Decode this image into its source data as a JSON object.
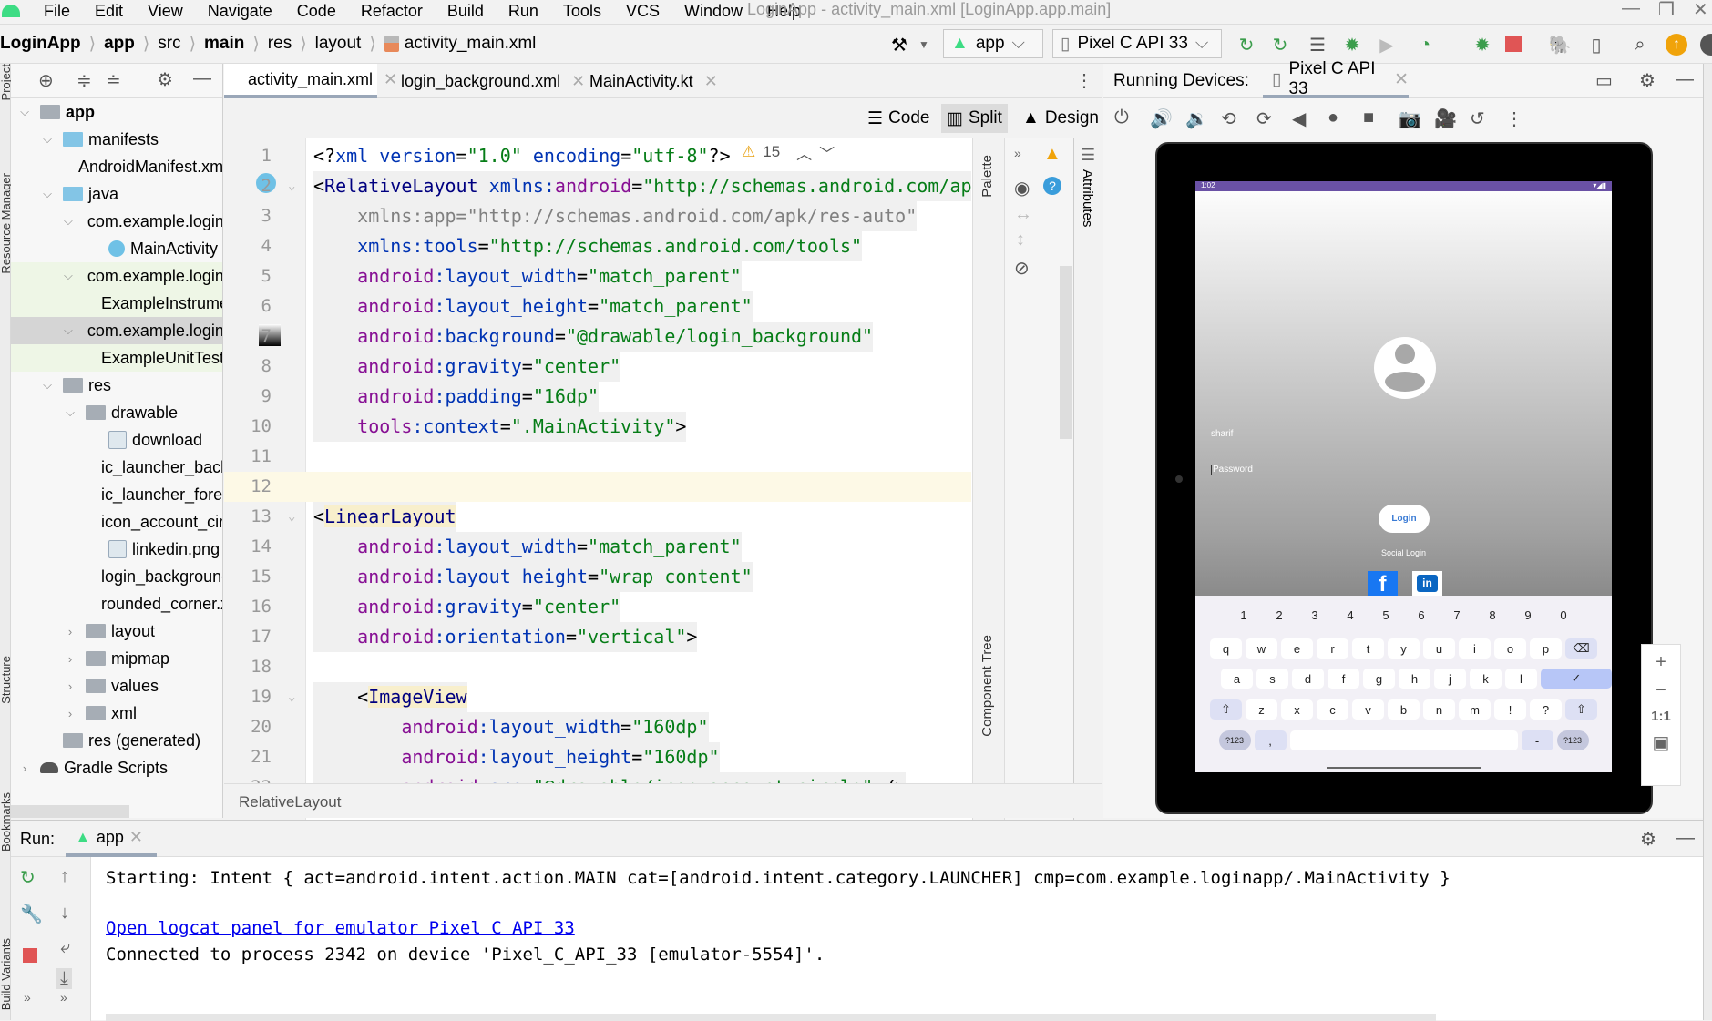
{
  "window": {
    "title": "LoginApp - activity_main.xml [LoginApp.app.main]"
  },
  "menu": [
    "File",
    "Edit",
    "View",
    "Navigate",
    "Code",
    "Refactor",
    "Build",
    "Run",
    "Tools",
    "VCS",
    "Window",
    "Help"
  ],
  "breadcrumb": [
    "LoginApp",
    "app",
    "src",
    "main",
    "res",
    "layout",
    "activity_main.xml"
  ],
  "toolbar": {
    "run_config": "app",
    "device": "Pixel C API 33",
    "icons": [
      "hammer-icon",
      "run-icon",
      "apply-changes-icon",
      "apply-code-icon",
      "debug-icon",
      "attach-debugger-icon",
      "profile-icon",
      "stop-icon",
      "gradle-sync-icon",
      "device-manager-icon",
      "search-icon",
      "update-icon"
    ]
  },
  "side_stripe": {
    "left": [
      "Project",
      "Resource Manager",
      "Structure",
      "Bookmarks",
      "Build Variants"
    ]
  },
  "project": {
    "items": [
      {
        "label": "app",
        "depth": 0,
        "chev": "v",
        "icon": "module",
        "bold": true
      },
      {
        "label": "manifests",
        "depth": 1,
        "chev": "v",
        "icon": "folder-blue"
      },
      {
        "label": "AndroidManifest.xml",
        "depth": 2,
        "icon": "manifest"
      },
      {
        "label": "java",
        "depth": 1,
        "chev": "v",
        "icon": "folder-blue"
      },
      {
        "label": "com.example.loginapp",
        "depth": 2,
        "chev": "v",
        "icon": "package"
      },
      {
        "label": "MainActivity",
        "depth": 3,
        "icon": "kotlin"
      },
      {
        "label": "com.example.loginapp (androidTest)",
        "depth": 2,
        "chev": "v",
        "icon": "package",
        "bg": "#eef6e6"
      },
      {
        "label": "ExampleInstrumentedTest",
        "depth": 3,
        "icon": "kotlin",
        "bg": "#eef6e6"
      },
      {
        "label": "com.example.loginapp (test)",
        "depth": 2,
        "chev": "v",
        "icon": "package",
        "bg": "#d5d5d5"
      },
      {
        "label": "ExampleUnitTest",
        "depth": 3,
        "icon": "kotlin",
        "bg": "#eef6e6"
      },
      {
        "label": "res",
        "depth": 1,
        "chev": "v",
        "icon": "res"
      },
      {
        "label": "drawable",
        "depth": 2,
        "chev": "v",
        "icon": "package"
      },
      {
        "label": "download",
        "depth": 3,
        "icon": "image"
      },
      {
        "label": "ic_launcher_background.xml",
        "depth": 3,
        "icon": "xml"
      },
      {
        "label": "ic_launcher_foreground.xml",
        "depth": 3,
        "icon": "xml"
      },
      {
        "label": "icon_account_circle.xml",
        "depth": 3,
        "icon": "xml"
      },
      {
        "label": "linkedin.png",
        "depth": 3,
        "icon": "image"
      },
      {
        "label": "login_background.xml",
        "depth": 3,
        "icon": "xml"
      },
      {
        "label": "rounded_corner.xml",
        "depth": 3,
        "icon": "xml"
      },
      {
        "label": "layout",
        "depth": 2,
        "chev": ">",
        "icon": "package"
      },
      {
        "label": "mipmap",
        "depth": 2,
        "chev": ">",
        "icon": "package"
      },
      {
        "label": "values",
        "depth": 2,
        "chev": ">",
        "icon": "package"
      },
      {
        "label": "xml",
        "depth": 2,
        "chev": ">",
        "icon": "package"
      },
      {
        "label": "res (generated)",
        "depth": 1,
        "icon": "res"
      },
      {
        "label": "Gradle Scripts",
        "depth": 0,
        "chev": ">",
        "icon": "gradle"
      }
    ]
  },
  "editor": {
    "tabs": [
      {
        "label": "activity_main.xml",
        "active": true
      },
      {
        "label": "login_background.xml"
      },
      {
        "label": "MainActivity.kt"
      }
    ],
    "modes": [
      "Code",
      "Split",
      "Design"
    ],
    "active_mode": "Split",
    "warnings": "15",
    "palette_label": "Palette",
    "component_tree_label": "Component Tree",
    "attributes_label": "Attributes",
    "footer_breadcrumb": "RelativeLayout",
    "current_line": 12,
    "lines": [
      [
        [
          "p",
          "<?"
        ],
        [
          "at",
          "xml version"
        ],
        [
          "p",
          "="
        ],
        [
          "v",
          "\"1.0\""
        ],
        [
          "at",
          " encoding"
        ],
        [
          "p",
          "="
        ],
        [
          "v",
          "\"utf-8\""
        ],
        [
          "p",
          "?>"
        ]
      ],
      [
        [
          "p",
          "<"
        ],
        [
          "tag",
          "RelativeLayout"
        ],
        [
          "at",
          " xmlns:"
        ],
        [
          "ns",
          "android"
        ],
        [
          "p",
          "="
        ],
        [
          "v",
          "\"http://schemas.android.com/apk/res/android\""
        ]
      ],
      [
        [
          "g",
          "    xmlns:app=\"http://schemas.android.com/apk/res-auto\""
        ]
      ],
      [
        [
          "at",
          "    xmlns:tools"
        ],
        [
          "p",
          "="
        ],
        [
          "v",
          "\"http://schemas.android.com/tools\""
        ]
      ],
      [
        [
          "ns",
          "    android"
        ],
        [
          "at",
          ":layout_width"
        ],
        [
          "p",
          "="
        ],
        [
          "v",
          "\"match_parent\""
        ]
      ],
      [
        [
          "ns",
          "    android"
        ],
        [
          "at",
          ":layout_height"
        ],
        [
          "p",
          "="
        ],
        [
          "v",
          "\"match_parent\""
        ]
      ],
      [
        [
          "ns",
          "    android"
        ],
        [
          "at",
          ":background"
        ],
        [
          "p",
          "="
        ],
        [
          "v",
          "\"@drawable/login_background\""
        ]
      ],
      [
        [
          "ns",
          "    android"
        ],
        [
          "at",
          ":gravity"
        ],
        [
          "p",
          "="
        ],
        [
          "v",
          "\"center\""
        ]
      ],
      [
        [
          "ns",
          "    android"
        ],
        [
          "at",
          ":padding"
        ],
        [
          "p",
          "="
        ],
        [
          "v",
          "\"16dp\""
        ]
      ],
      [
        [
          "ns",
          "    tools"
        ],
        [
          "at",
          ":context"
        ],
        [
          "p",
          "="
        ],
        [
          "v",
          "\".MainActivity\""
        ],
        [
          "p",
          ">"
        ]
      ],
      [],
      [],
      [
        [
          "p",
          "<"
        ],
        [
          "hl",
          "LinearLayout"
        ]
      ],
      [
        [
          "ns",
          "    android"
        ],
        [
          "at",
          ":layout_width"
        ],
        [
          "p",
          "="
        ],
        [
          "v",
          "\"match_parent\""
        ]
      ],
      [
        [
          "ns",
          "    android"
        ],
        [
          "at",
          ":layout_height"
        ],
        [
          "p",
          "="
        ],
        [
          "v",
          "\"wrap_content\""
        ]
      ],
      [
        [
          "ns",
          "    android"
        ],
        [
          "at",
          ":gravity"
        ],
        [
          "p",
          "="
        ],
        [
          "v",
          "\"center\""
        ]
      ],
      [
        [
          "ns",
          "    android"
        ],
        [
          "at",
          ":orientation"
        ],
        [
          "p",
          "="
        ],
        [
          "v",
          "\"vertical\""
        ],
        [
          "p",
          ">"
        ]
      ],
      [],
      [
        [
          "p",
          "    <"
        ],
        [
          "hl",
          "ImageView"
        ]
      ],
      [
        [
          "ns",
          "        android"
        ],
        [
          "at",
          ":layout_width"
        ],
        [
          "p",
          "="
        ],
        [
          "v",
          "\"160dp\""
        ]
      ],
      [
        [
          "ns",
          "        android"
        ],
        [
          "at",
          ":layout_height"
        ],
        [
          "p",
          "="
        ],
        [
          "v",
          "\"160dp\""
        ]
      ],
      [
        [
          "ns",
          "        android"
        ],
        [
          "at",
          ":src"
        ],
        [
          "p",
          "="
        ],
        [
          "v",
          "\"@drawable/icon_account_circle\""
        ],
        [
          "p",
          " />"
        ]
      ]
    ]
  },
  "devices": {
    "label": "Running Devices:",
    "tab": "Pixel C API 33",
    "controls": [
      "power-icon",
      "volume-up-icon",
      "volume-down-icon",
      "rotate-left-icon",
      "rotate-right-icon",
      "back-icon",
      "home-icon",
      "overview-icon",
      "screenshot-icon",
      "screen-record-icon",
      "snapshot-icon",
      "more-icon"
    ],
    "zoom": [
      "+",
      "−",
      "1:1"
    ]
  },
  "app_screen": {
    "status_time": "1:02",
    "username": "sharif",
    "password_hint": "Password",
    "login_button": "Login",
    "social_label": "Social Login",
    "status_color": "#6a51a5",
    "keyboard": {
      "numbers": [
        "1",
        "2",
        "3",
        "4",
        "5",
        "6",
        "7",
        "8",
        "9",
        "0"
      ],
      "row1": [
        "q",
        "w",
        "e",
        "r",
        "t",
        "y",
        "u",
        "i",
        "o",
        "p",
        "⌫"
      ],
      "row2": [
        "a",
        "s",
        "d",
        "f",
        "g",
        "h",
        "j",
        "k",
        "l",
        "✓"
      ],
      "row3": [
        "⇧",
        "z",
        "x",
        "c",
        "v",
        "b",
        "n",
        "m",
        "!",
        "?",
        "⇧"
      ],
      "row4": [
        "?123",
        ",",
        "",
        "-",
        "?123"
      ]
    }
  },
  "run": {
    "label": "Run:",
    "tab": "app",
    "output": [
      {
        "text": "Starting: Intent { act=android.intent.action.MAIN cat=[android.intent.category.LAUNCHER] cmp=com.example.loginapp/.MainActivity }"
      },
      {
        "text": "Open logcat panel for emulator Pixel C API 33",
        "link": true
      },
      {
        "text": "Connected to process 2342 on device 'Pixel_C_API_33 [emulator-5554]'."
      }
    ]
  }
}
